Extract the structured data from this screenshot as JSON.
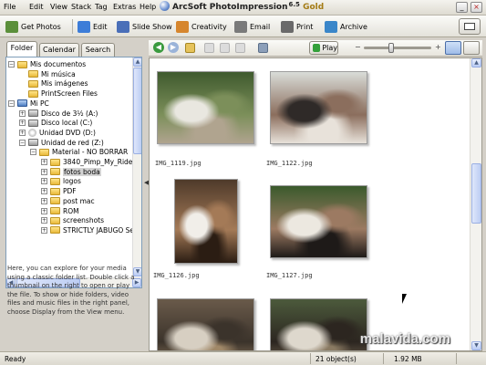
{
  "menu": {
    "items": [
      {
        "label": "File"
      },
      {
        "label": "Edit"
      },
      {
        "label": "View"
      },
      {
        "label": "Stack"
      },
      {
        "label": "Tag"
      },
      {
        "label": "Extras"
      },
      {
        "label": "Help"
      }
    ]
  },
  "app": {
    "title": "ArcSoft PhotoImpression",
    "version": "6.5",
    "edition": "Gold",
    "minimize_glyph": "_",
    "close_glyph": "×"
  },
  "toolbar": {
    "buttons": [
      {
        "label": "Get Photos",
        "icon": "camera-icon",
        "color": "#5b8f3a"
      },
      {
        "label": "Edit",
        "icon": "wand-icon",
        "color": "#3d7dd8"
      },
      {
        "label": "Slide Show",
        "icon": "slideshow-icon",
        "color": "#4a6fb8"
      },
      {
        "label": "Creativity",
        "icon": "palette-icon",
        "color": "#d6862e"
      },
      {
        "label": "Email",
        "icon": "envelope-icon",
        "color": "#7a7a7a"
      },
      {
        "label": "Print",
        "icon": "printer-icon",
        "color": "#6a6a6a"
      },
      {
        "label": "Archive",
        "icon": "disc-icon",
        "color": "#3a86c9"
      }
    ]
  },
  "tabs": [
    {
      "label": "Folder",
      "active": true
    },
    {
      "label": "Calendar",
      "active": false
    },
    {
      "label": "Search",
      "active": false
    }
  ],
  "tree": [
    {
      "label": "Mis documentos",
      "level": 0,
      "exp": "−",
      "icon": "folder"
    },
    {
      "label": "Mi música",
      "level": 1,
      "exp": "",
      "icon": "folder"
    },
    {
      "label": "Mis imágenes",
      "level": 1,
      "exp": "",
      "icon": "folder"
    },
    {
      "label": "PrintScreen Files",
      "level": 1,
      "exp": "",
      "icon": "folder"
    },
    {
      "label": "Mi PC",
      "level": 0,
      "exp": "−",
      "icon": "pc"
    },
    {
      "label": "Disco de 3½ (A:)",
      "level": 1,
      "exp": "+",
      "icon": "drive"
    },
    {
      "label": "Disco local (C:)",
      "level": 1,
      "exp": "+",
      "icon": "drive"
    },
    {
      "label": "Unidad DVD (D:)",
      "level": 1,
      "exp": "+",
      "icon": "cd"
    },
    {
      "label": "Unidad de red (Z:)",
      "level": 1,
      "exp": "−",
      "icon": "drive"
    },
    {
      "label": "Material - NO BORRAR",
      "level": 2,
      "exp": "−",
      "icon": "folder"
    },
    {
      "label": "3840_Pimp_My_Ride_",
      "level": 3,
      "exp": "+",
      "icon": "folder"
    },
    {
      "label": "fotos boda",
      "level": 3,
      "exp": "+",
      "icon": "folder",
      "selected": true
    },
    {
      "label": "logos",
      "level": 3,
      "exp": "+",
      "icon": "folder"
    },
    {
      "label": "PDF",
      "level": 3,
      "exp": "+",
      "icon": "folder"
    },
    {
      "label": "post mac",
      "level": 3,
      "exp": "+",
      "icon": "folder"
    },
    {
      "label": "ROM",
      "level": 3,
      "exp": "+",
      "icon": "folder"
    },
    {
      "label": "screenshots",
      "level": 3,
      "exp": "+",
      "icon": "folder"
    },
    {
      "label": "STRICTLY JABUGO Se",
      "level": 3,
      "exp": "+",
      "icon": "folder"
    }
  ],
  "help": "Here, you can explore for your media using a classic folder list. Double click a thumbnail on the right to open or play the file. To show or hide folders, video files and music files in the right panel, choose Display from the View menu.",
  "browser": {
    "play_label": "Play",
    "zoom_minus": "−",
    "zoom_plus": "+",
    "zoom_level": 0.4
  },
  "thumbnails": [
    {
      "caption": "IMG_1119.jpg",
      "palette": [
        "#3f5a2e",
        "#e9e7e0",
        "#7c8f5a",
        "#b0a48f"
      ]
    },
    {
      "caption": "IMG_1122.jpg",
      "palette": [
        "#d9dcd8",
        "#2f2a28",
        "#8b6e5d",
        "#e8e2da"
      ]
    },
    {
      "caption": "IMG_1126.jpg",
      "palette": [
        "#4e3a2a",
        "#f1eee9",
        "#a47a57",
        "#2b1d13"
      ]
    },
    {
      "caption": "IMG_1127.jpg",
      "palette": [
        "#3a5a2c",
        "#ece8e0",
        "#9c7a62",
        "#1e1a18"
      ]
    },
    {
      "caption": "",
      "palette": [
        "#6a5a4a",
        "#d7cfc2",
        "#3b332b",
        "#a08868"
      ]
    },
    {
      "caption": "",
      "palette": [
        "#4c5a3c",
        "#ded8cd",
        "#2c2620",
        "#8a7a62"
      ]
    }
  ],
  "status": {
    "left": "Ready",
    "count": "21 object(s)",
    "size": "1.92 MB"
  },
  "watermark": "malavida.com"
}
